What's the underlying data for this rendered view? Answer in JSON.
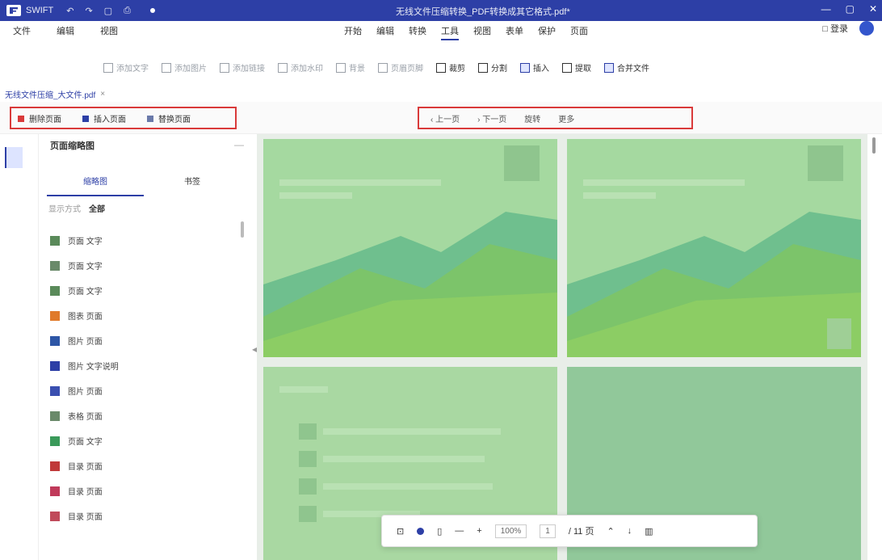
{
  "titlebar": {
    "app_name": "SWIFT",
    "quick_icons": [
      "↶",
      "↷",
      "▢",
      "⎙"
    ],
    "doc_title": "无线文件压缩转换_PDF转换成其它格式.pdf*",
    "win_controls": [
      "—",
      "▢",
      "✕"
    ]
  },
  "menu": {
    "left": [
      "文件",
      "编辑",
      "视图"
    ],
    "center": [
      "开始",
      "编辑",
      "转换",
      "工具",
      "视图",
      "表单",
      "保护",
      "页面"
    ],
    "active_center": "工具",
    "right_label": "□ 登录",
    "toolrow": [
      "添加文字",
      "添加图片",
      "添加链接",
      "添加水印",
      "背景",
      "页眉页脚",
      "裁剪",
      "分割",
      "插入",
      "提取",
      "合并文件"
    ]
  },
  "file_tab": {
    "name": "无线文件压缩_大文件.pdf",
    "close": "×"
  },
  "subbar": {
    "left": [
      "删除页面",
      "插入页面",
      "替换页面"
    ],
    "center": [
      "‹ 上一页",
      "› 下一页",
      "旋转",
      "更多"
    ]
  },
  "sidebar": {
    "header": "页面缩略图",
    "collapse": "—",
    "tabs": [
      "缩略图",
      "书签"
    ],
    "filter_label": "显示方式",
    "filter_value": "全部",
    "items": [
      {
        "label": "页面 文字",
        "color": "#5a8a5a"
      },
      {
        "label": "页面 文字",
        "color": "#6a8a6a"
      },
      {
        "label": "页面 文字",
        "color": "#5a8a5a"
      },
      {
        "label": "图表 页面",
        "color": "#e07a2a"
      },
      {
        "label": "图片 页面",
        "color": "#2d56a6"
      },
      {
        "label": "图片 文字说明",
        "color": "#2d3fa6"
      },
      {
        "label": "图片 页面",
        "color": "#3a4fb0"
      },
      {
        "label": "表格 页面",
        "color": "#6a8a6a"
      },
      {
        "label": "页面 文字",
        "color": "#3a9a5a"
      },
      {
        "label": "目录 页面",
        "color": "#c03a3a"
      },
      {
        "label": "目录 页面",
        "color": "#c03a5a"
      },
      {
        "label": "目录 页面",
        "color": "#c04a5a"
      }
    ]
  },
  "floatbar": {
    "zoom": "100%",
    "page": "1",
    "total": "/ 11 页",
    "icons": [
      "⊡",
      "●",
      "▯",
      "—",
      "+",
      "⌃",
      "↓",
      "▥"
    ]
  },
  "colors": {
    "accent": "#2d3fa6",
    "highlight_border": "#d93a3a",
    "page_green": "#a5d9a0"
  }
}
